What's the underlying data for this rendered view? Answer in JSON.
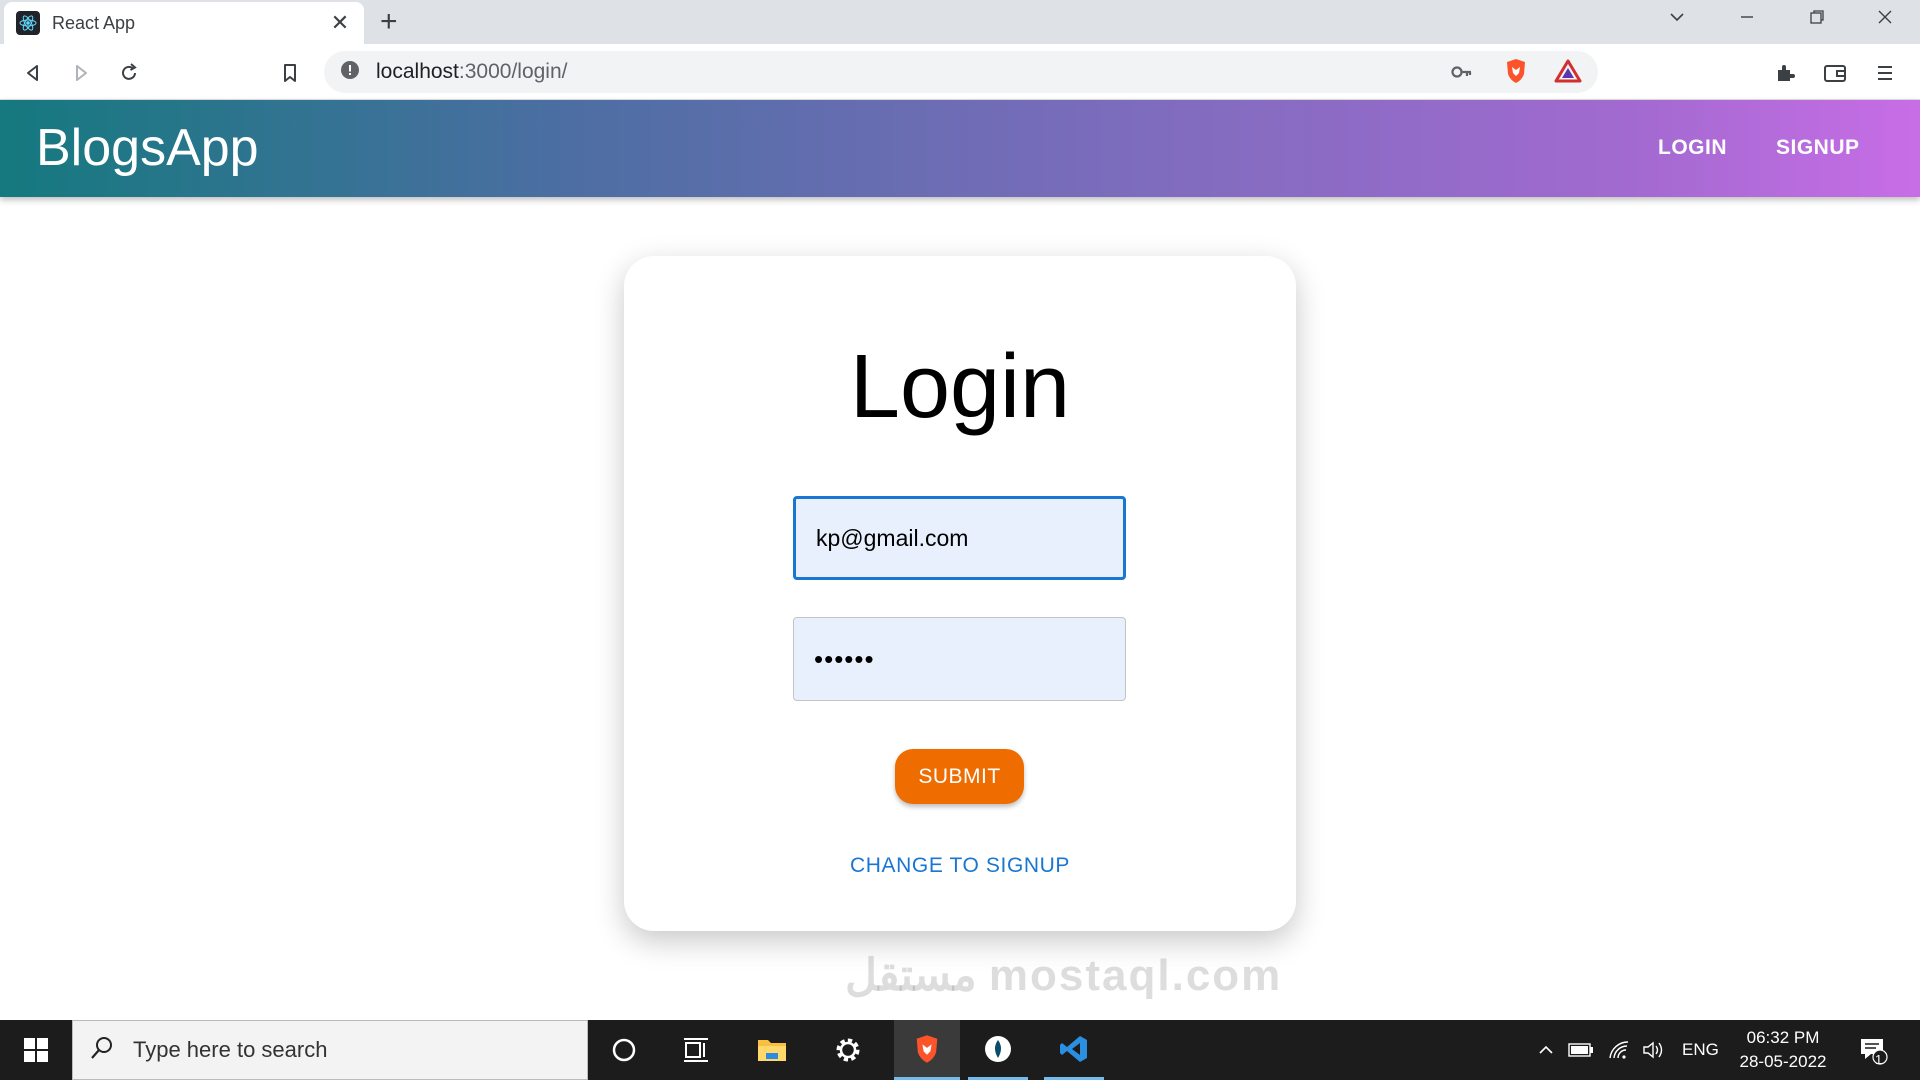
{
  "browser": {
    "tab_title": "React App",
    "url_host": "localhost",
    "url_path": ":3000/login/"
  },
  "header": {
    "brand": "BlogsApp",
    "nav": {
      "login": "LOGIN",
      "signup": "SIGNUP"
    },
    "gradient": [
      "#15797f",
      "#c86de6"
    ]
  },
  "form": {
    "title": "Login",
    "email_value": "kp@gmail.com",
    "password_value": "••••••",
    "submit_label": "SUBMIT",
    "switch_label": "CHANGE TO SIGNUP",
    "accent": "#ef6c00",
    "link_color": "#1976d2"
  },
  "watermark": "مستقل mostaql.com",
  "taskbar": {
    "search_placeholder": "Type here to search",
    "language": "ENG",
    "time": "06:32 PM",
    "date": "28-05-2022",
    "notification_count": "1"
  }
}
